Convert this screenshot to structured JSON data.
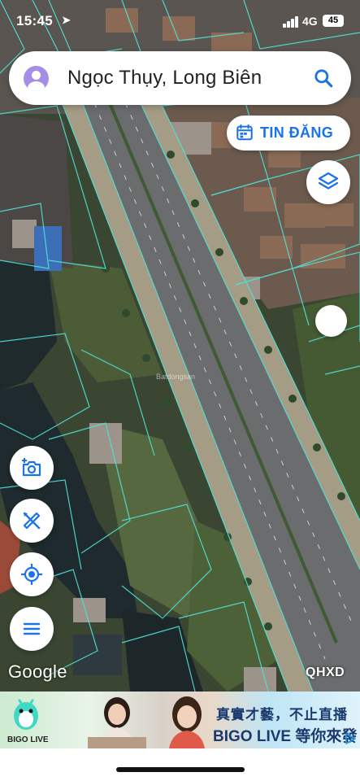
{
  "status_bar": {
    "time": "15:45",
    "network": "4G",
    "battery": "45"
  },
  "search": {
    "title": "Ngọc Thụy, Long Biên"
  },
  "post_button": {
    "label": "TIN ĐĂNG"
  },
  "map": {
    "attribution": "Google",
    "overlay_label": "QHXD",
    "watermark": "Batdongsan",
    "parcel_line_color": "#4fe3d8"
  },
  "ad": {
    "logo_text": "BIGO LIVE",
    "headline": "真實才藝，不止直播",
    "brand_line": "BIGO LIVE 等你來發掘"
  },
  "icons": {
    "location": "location-arrow-icon",
    "search": "search-icon",
    "calendar": "calendar-icon",
    "layers": "layers-icon",
    "camera": "camera-add-icon",
    "measure": "ruler-pencil-icon",
    "locate": "my-location-icon",
    "menu": "menu-icon",
    "ad_play": "ad-choices-icon"
  },
  "colors": {
    "accent": "#1a73e8",
    "avatar": "#a68ee8"
  }
}
